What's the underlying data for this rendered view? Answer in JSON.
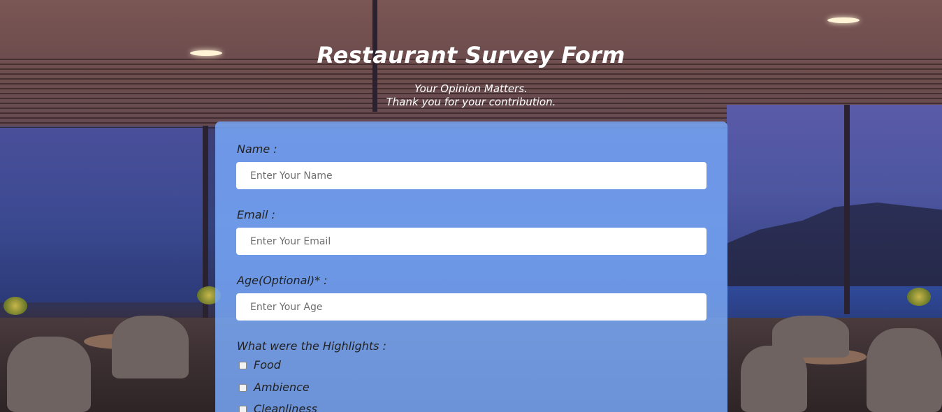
{
  "header": {
    "title": "Restaurant Survey Form",
    "subtitle_line1": "Your Opinion Matters.",
    "subtitle_line2": "Thank you for your contribution."
  },
  "form": {
    "name": {
      "label": "Name :",
      "placeholder": "Enter Your Name",
      "value": ""
    },
    "email": {
      "label": "Email :",
      "placeholder": "Enter Your Email",
      "value": ""
    },
    "age": {
      "label": "Age(Optional)* :",
      "placeholder": "Enter Your Age",
      "value": ""
    },
    "highlights": {
      "label": "What were the Highlights :",
      "options": [
        {
          "label": "Food",
          "checked": false
        },
        {
          "label": "Ambience",
          "checked": false
        },
        {
          "label": "Cleanliness",
          "checked": false
        }
      ]
    }
  },
  "colors": {
    "form_card": "#7aacff",
    "title_text": "#ffffff",
    "label_text": "#222222"
  }
}
